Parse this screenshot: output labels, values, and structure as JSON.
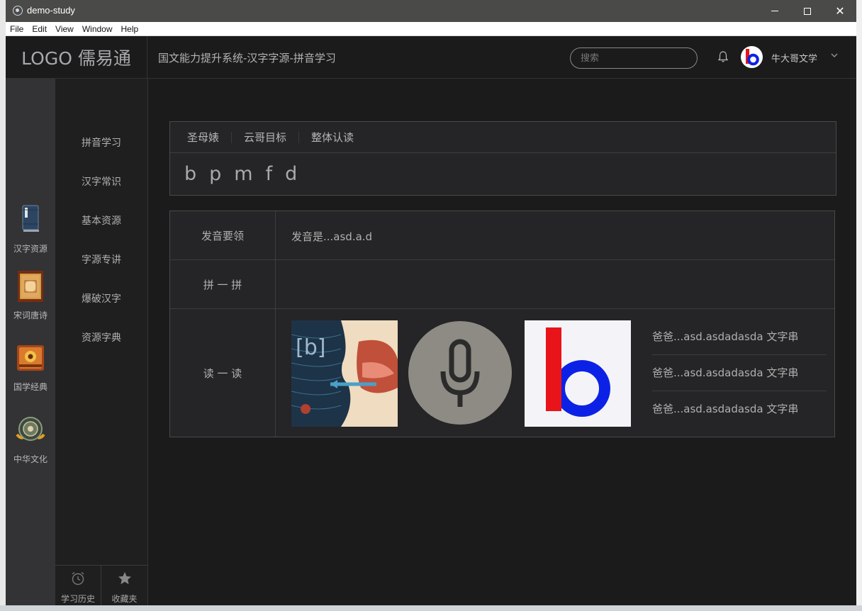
{
  "window": {
    "title": "demo-study"
  },
  "menu": [
    "File",
    "Edit",
    "View",
    "Window",
    "Help"
  ],
  "header": {
    "logo": "LOGO 儒易通",
    "breadcrumb": "国文能力提升系统-汉字字源-拼音学习",
    "search_placeholder": "搜索",
    "username": "牛大哥文学"
  },
  "rail": [
    {
      "label": "汉字资源",
      "icon": "book-icon"
    },
    {
      "label": "宋词唐诗",
      "icon": "scroll-frame-icon"
    },
    {
      "label": "国学经典",
      "icon": "classic-book-icon"
    },
    {
      "label": "中华文化",
      "icon": "culture-emblem-icon"
    }
  ],
  "nav": {
    "items": [
      "拼音学习",
      "汉字常识",
      "基本资源",
      "字源专讲",
      "爆破汉字",
      "资源字典"
    ],
    "history_label": "学习历史",
    "favorites_label": "收藏夹"
  },
  "tabs": [
    "圣母婊",
    "云哥目标",
    "整体认读"
  ],
  "letters": [
    "b",
    "p",
    "m",
    "f",
    "d"
  ],
  "detail": {
    "row1_label": "发音要领",
    "row1_value": "发音是...asd.a.d",
    "row2_label": "拼 一 拼",
    "row3_label": "读 一 读",
    "readings": [
      "爸爸...asd.asdadasda 文字串",
      "爸爸...asd.asdadasda 文字串",
      "爸爸...asd.asdadasda 文字串"
    ]
  },
  "colors": {
    "background": "#1b1b1c",
    "panel": "#252426",
    "accent_red": "#e8141a",
    "accent_blue": "#0b22e6"
  }
}
